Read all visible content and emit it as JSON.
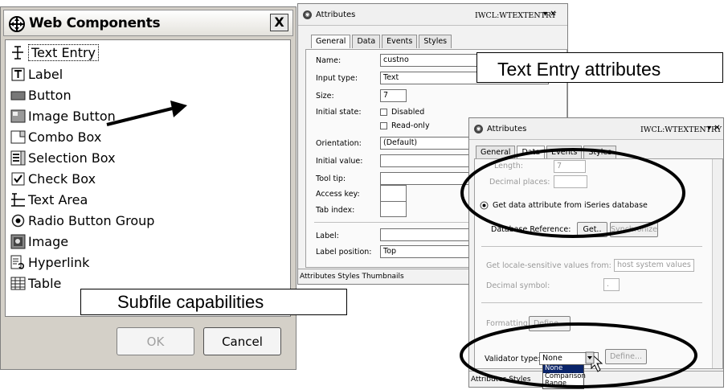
{
  "web_components": {
    "title": "Web Components",
    "close_label": "X",
    "items": [
      {
        "label": "Text Entry",
        "icon": "text-entry-icon"
      },
      {
        "label": "Label",
        "icon": "label-icon"
      },
      {
        "label": "Button",
        "icon": "button-icon"
      },
      {
        "label": "Image Button",
        "icon": "image-button-icon"
      },
      {
        "label": "Combo Box",
        "icon": "combo-box-icon"
      },
      {
        "label": "Selection Box",
        "icon": "selection-box-icon"
      },
      {
        "label": "Check Box",
        "icon": "check-box-icon"
      },
      {
        "label": "Text Area",
        "icon": "text-area-icon"
      },
      {
        "label": "Radio Button Group",
        "icon": "radio-button-group-icon"
      },
      {
        "label": "Image",
        "icon": "image-icon"
      },
      {
        "label": "Hyperlink",
        "icon": "hyperlink-icon"
      },
      {
        "label": "Table",
        "icon": "table-icon"
      }
    ],
    "ok_label": "OK",
    "cancel_label": "Cancel"
  },
  "callouts": {
    "subfile": "Subfile capabilities",
    "text_entry": "Text Entry attributes"
  },
  "attributes_back": {
    "title": "Attributes",
    "id": "IWCL:WTEXTENTRY",
    "controls": "▾  ✕",
    "tabs": [
      "General",
      "Data",
      "Events",
      "Styles"
    ],
    "fields": {
      "name_label": "Name:",
      "name_value": "custno",
      "input_type_label": "Input type:",
      "input_type_value": "Text",
      "size_label": "Size:",
      "size_value": "7",
      "initial_state_label": "Initial state:",
      "disabled_label": "Disabled",
      "readonly_label": "Read-only",
      "orientation_label": "Orientation:",
      "orientation_value": "(Default)",
      "initial_value_label": "Initial value:",
      "tooltip_label": "Tool tip:",
      "access_key_label": "Access key:",
      "tab_index_label": "Tab index:",
      "label_label": "Label:",
      "label_position_label": "Label position:",
      "label_position_value": "Top"
    },
    "bottom_tabs": "Attributes Styles Thumbnails"
  },
  "attributes_front": {
    "title": "Attributes",
    "id": "IWCL:WTEXTENTRY",
    "controls": "▾  ✕",
    "tabs": [
      "General",
      "Data",
      "Events",
      "Styles"
    ],
    "length_label": "Length:",
    "length_value": "7",
    "decimal_places_label": "Decimal places:",
    "radio_label": "Get data attribute from iSeries database",
    "db_ref_label": "Database Reference:",
    "get_label": "Get..",
    "sync_label": "Synchronize",
    "locale_label": "Get locale-sensitive values from:",
    "locale_value": "host system values",
    "decimal_symbol_label": "Decimal symbol:",
    "decimal_symbol_value": ".",
    "formatting_label": "Formatting:",
    "define1_label": "Define...",
    "validator_label": "Validator type:",
    "validator_value": "None",
    "define2_label": "Define...",
    "dropdown_options": [
      "None",
      "Comparison",
      "Range"
    ],
    "bottom_tabs_a": "Attributes",
    "bottom_tabs_b": "Styles"
  }
}
